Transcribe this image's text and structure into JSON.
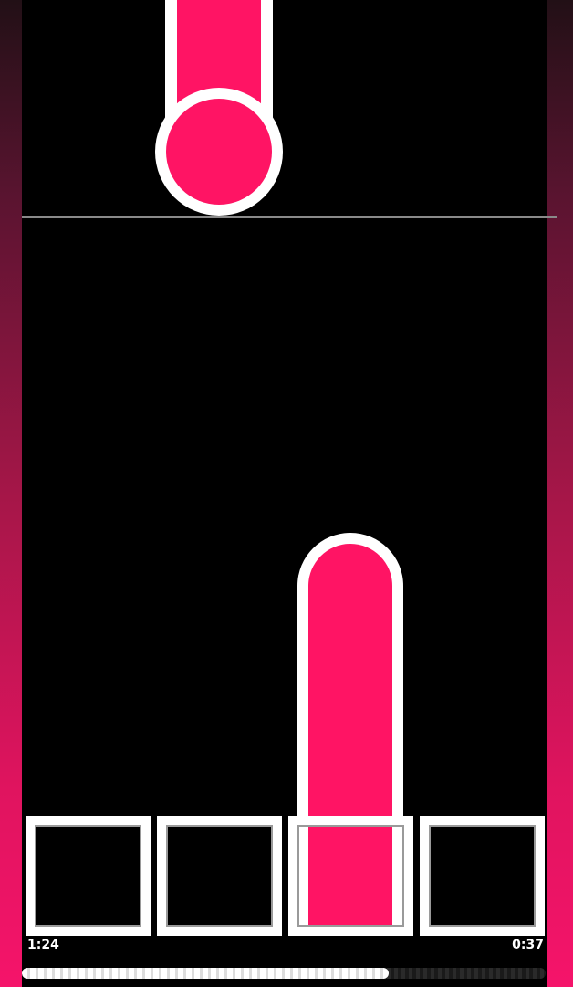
{
  "game": {
    "accent_color": "#ff1464",
    "outline_color": "#ffffff",
    "lanes": [
      "lane-1",
      "lane-2",
      "lane-3",
      "lane-4"
    ],
    "active_lane": 3,
    "notes": [
      {
        "type": "hold",
        "lane": 2,
        "state": "falling"
      },
      {
        "type": "hold",
        "lane": 3,
        "state": "pressed"
      }
    ]
  },
  "timer": {
    "elapsed": "1:24",
    "remaining": "0:37"
  },
  "progress": {
    "fraction": 0.7
  }
}
